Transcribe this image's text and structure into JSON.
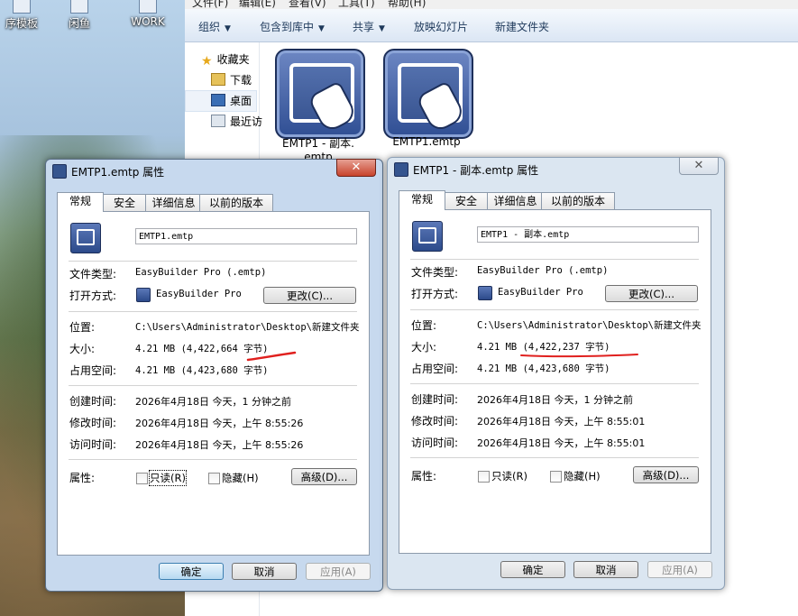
{
  "desktop": {
    "icons": [
      {
        "label": "序模板"
      },
      {
        "label": "闲鱼"
      },
      {
        "label": "WORK"
      }
    ]
  },
  "explorer": {
    "menu": [
      "文件(F)",
      "编辑(E)",
      "查看(V)",
      "工具(T)",
      "帮助(H)"
    ],
    "toolbar": {
      "organize": "组织",
      "include": "包含到库中",
      "share": "共享",
      "slideshow": "放映幻灯片",
      "new_folder": "新建文件夹"
    },
    "nav": {
      "favorites": "收藏夹",
      "downloads": "下载",
      "desktop": "桌面",
      "recent": "最近访"
    },
    "files": [
      {
        "name": "EMTP1 - 副本.emtp",
        "name_line1": "EMTP1 - 副本.",
        "name_line2": "emtp"
      },
      {
        "name": "EMTP1.emtp"
      }
    ]
  },
  "dialogs": [
    {
      "title": "EMTP1.emtp 属性",
      "state": "active",
      "tabs": [
        "常规",
        "安全",
        "详细信息",
        "以前的版本"
      ],
      "filename": "EMTP1.emtp",
      "file_type_label": "文件类型:",
      "file_type": "EasyBuilder Pro (.emtp)",
      "open_with_label": "打开方式:",
      "open_with": "EasyBuilder Pro",
      "change_button": "更改(C)...",
      "location_label": "位置:",
      "location": "C:\\Users\\Administrator\\Desktop\\新建文件夹",
      "size_label": "大小:",
      "size": "4.21 MB (4,422,664 字节)",
      "size_on_disk_label": "占用空间:",
      "size_on_disk": "4.21 MB (4,423,680 字节)",
      "created_label": "创建时间:",
      "created": "2026年4月18日 今天，1 分钟之前",
      "modified_label": "修改时间:",
      "modified": "2026年4月18日 今天，上午 8:55:26",
      "accessed_label": "访问时间:",
      "accessed": "2026年4月18日 今天，上午 8:55:26",
      "attributes_label": "属性:",
      "readonly": "只读(R)",
      "hidden": "隐藏(H)",
      "advanced_button": "高级(D)...",
      "ok": "确定",
      "cancel": "取消",
      "apply": "应用(A)"
    },
    {
      "title": "EMTP1 - 副本.emtp 属性",
      "state": "inactive",
      "tabs": [
        "常规",
        "安全",
        "详细信息",
        "以前的版本"
      ],
      "filename": "EMTP1 - 副本.emtp",
      "file_type_label": "文件类型:",
      "file_type": "EasyBuilder Pro (.emtp)",
      "open_with_label": "打开方式:",
      "open_with": "EasyBuilder Pro",
      "change_button": "更改(C)...",
      "location_label": "位置:",
      "location": "C:\\Users\\Administrator\\Desktop\\新建文件夹",
      "size_label": "大小:",
      "size": "4.21 MB (4,422,237 字节)",
      "size_on_disk_label": "占用空间:",
      "size_on_disk": "4.21 MB (4,423,680 字节)",
      "created_label": "创建时间:",
      "created": "2026年4月18日 今天，1 分钟之前",
      "modified_label": "修改时间:",
      "modified": "2026年4月18日 今天，上午 8:55:01",
      "accessed_label": "访问时间:",
      "accessed": "2026年4月18日 今天，上午 8:55:01",
      "attributes_label": "属性:",
      "readonly": "只读(R)",
      "hidden": "隐藏(H)",
      "advanced_button": "高级(D)...",
      "ok": "确定",
      "cancel": "取消",
      "apply": "应用(A)"
    }
  ],
  "colors": {
    "annotation_red": "#e0201e",
    "title_active": "#c7d9ee",
    "title_inactive": "#dbe6f1"
  }
}
